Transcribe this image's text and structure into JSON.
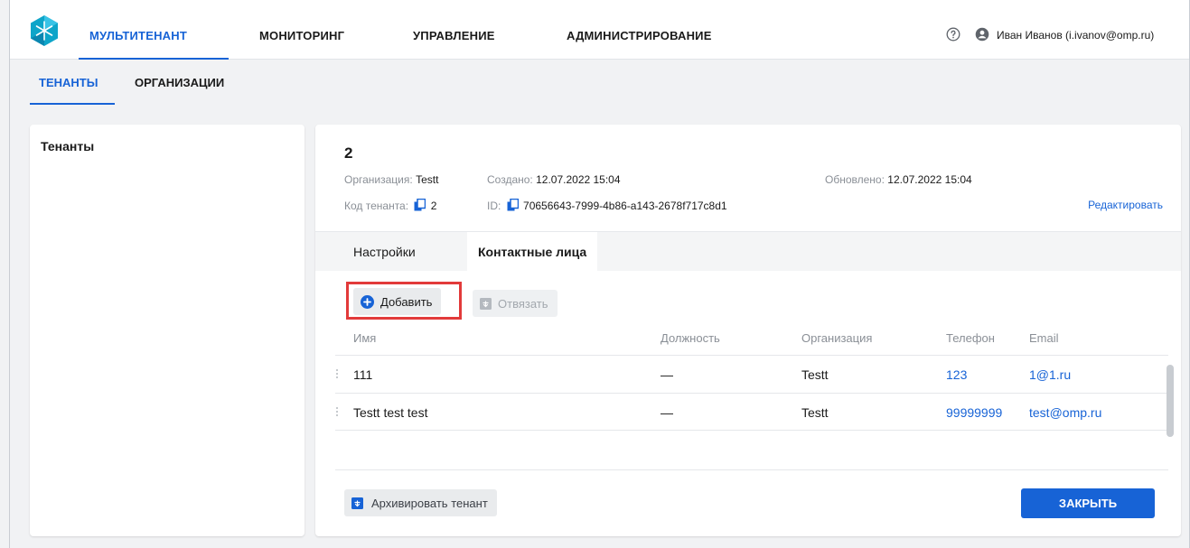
{
  "colors": {
    "accent": "#1763d6",
    "highlight": "#e23a3a",
    "logo": "#0ea5c9"
  },
  "topnav": {
    "items": [
      "МУЛЬТИТЕНАНТ",
      "МОНИТОРИНГ",
      "УПРАВЛЕНИЕ",
      "АДМИНИСТРИРОВАНИЕ"
    ],
    "active_index": 0,
    "help_icon": "question-circle-icon",
    "user_icon": "account-circle-icon",
    "user_name": "Иван Иванов (i.ivanov@omp.ru)"
  },
  "subtabs": {
    "items": [
      "ТЕНАНТЫ",
      "ОРГАНИЗАЦИИ"
    ],
    "active_index": 0
  },
  "left_panel": {
    "title": "Тенанты"
  },
  "tenant": {
    "name": "2",
    "org_label": "Организация:",
    "org_value": "Testt",
    "created_label": "Создано:",
    "created_value": "12.07.2022 15:04",
    "updated_label": "Обновлено:",
    "updated_value": "12.07.2022 15:04",
    "code_label": "Код тенанта:",
    "code_value": "2",
    "id_label": "ID:",
    "id_value": "70656643-7999-4b86-a143-2678f717c8d1",
    "edit_label": "Редактировать"
  },
  "detail_tabs": {
    "items": [
      "Настройки",
      "Контактные лица"
    ],
    "active_index": 1
  },
  "actions": {
    "add_label": "Добавить",
    "unlink_label": "Отвязать"
  },
  "table": {
    "headers": [
      "Имя",
      "Должность",
      "Организация",
      "Телефон",
      "Email"
    ],
    "rows": [
      [
        "111",
        "—",
        "Testt",
        "123",
        "1@1.ru"
      ],
      [
        "Testt test test",
        "—",
        "Testt",
        "99999999",
        "test@omp.ru"
      ]
    ]
  },
  "footer": {
    "archive_label": "Архивировать тенант",
    "close_label": "ЗАКРЫТЬ"
  }
}
